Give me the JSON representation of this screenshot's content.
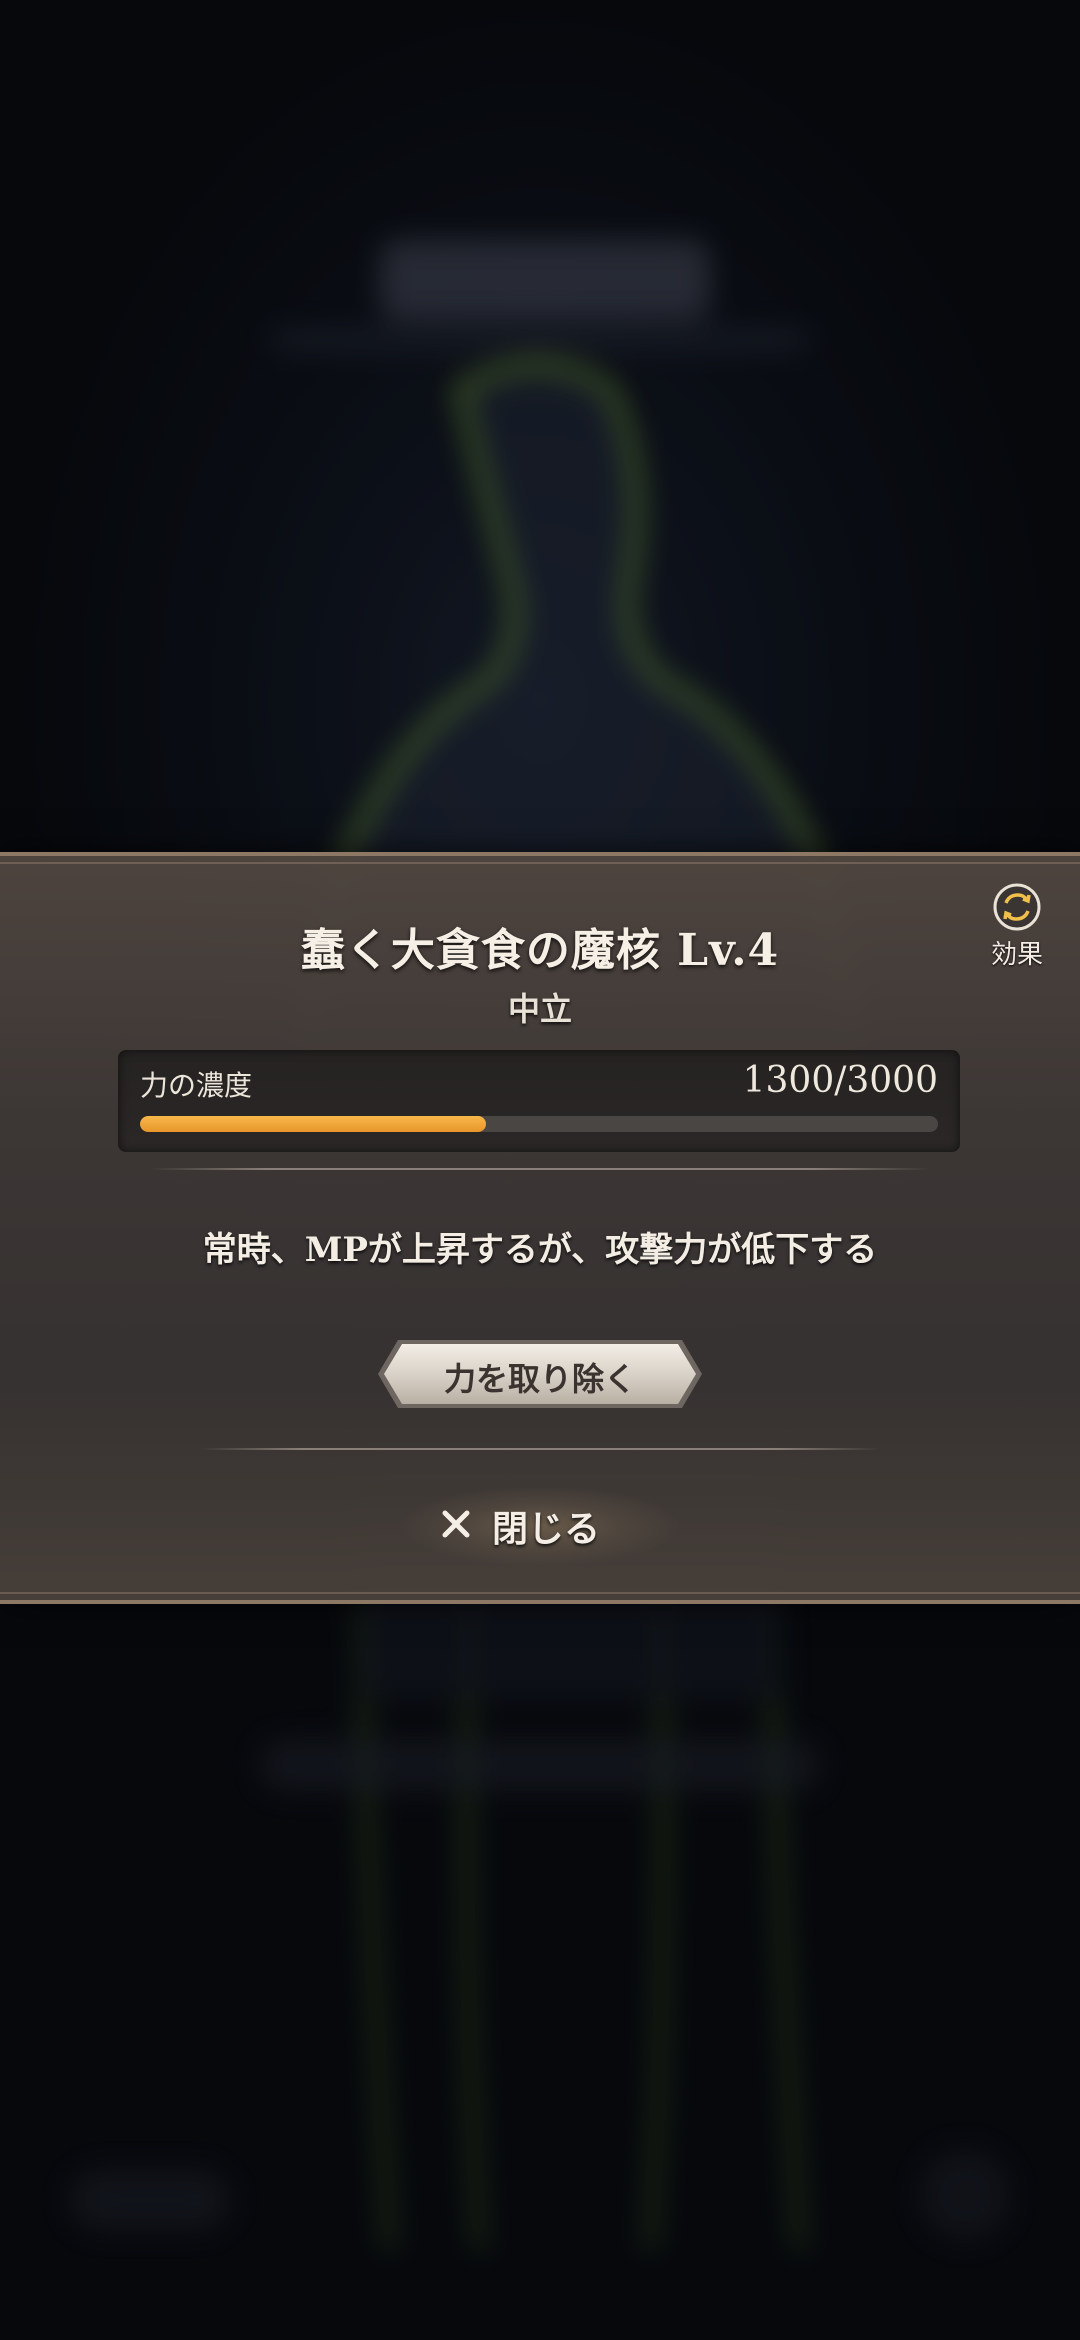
{
  "dialog": {
    "title": "蠢く大貪食の魔核 Lv.4",
    "alignment": "中立",
    "effect_button": {
      "label": "効果",
      "icon": "swap-icon"
    },
    "gauge": {
      "label": "力の濃度",
      "value_text": "1300/3000",
      "current": 1300,
      "max": 3000
    },
    "description": "常時、MPが上昇するが、攻撃力が低下する",
    "remove_button": {
      "label": "力を取り除く"
    },
    "close_button": {
      "label": "閉じる",
      "icon": "close-icon"
    }
  },
  "colors": {
    "accent_fill": "#f0a63a",
    "panel_border": "#8d7866",
    "figure_outline": "#9fd24a"
  }
}
